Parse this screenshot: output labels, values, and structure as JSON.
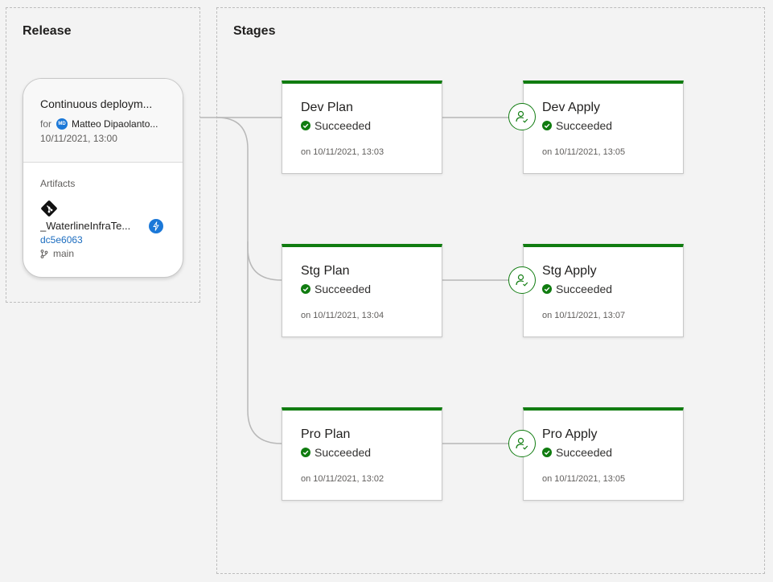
{
  "release_section": {
    "title": "Release"
  },
  "stages_section": {
    "title": "Stages"
  },
  "release_card": {
    "title": "Continuous deploym...",
    "for_label": "for",
    "user_initials": "MD",
    "user": "Matteo Dipaolanto...",
    "time": "10/11/2021, 13:00",
    "artifacts_label": "Artifacts",
    "artifact_icon": "git-icon",
    "artifact_name": "_WaterlineInfraTe...",
    "trigger_icon": "lightning-bolt-icon",
    "commit": "dc5e6063",
    "branch_icon": "branch-icon",
    "branch": "main"
  },
  "stages": {
    "dev_plan": {
      "name": "Dev Plan",
      "status": "Succeeded",
      "time": "on 10/11/2021, 13:03"
    },
    "dev_apply": {
      "name": "Dev Apply",
      "status": "Succeeded",
      "time": "on 10/11/2021, 13:05"
    },
    "stg_plan": {
      "name": "Stg Plan",
      "status": "Succeeded",
      "time": "on 10/11/2021, 13:04"
    },
    "stg_apply": {
      "name": "Stg Apply",
      "status": "Succeeded",
      "time": "on 10/11/2021, 13:07"
    },
    "pro_plan": {
      "name": "Pro Plan",
      "status": "Succeeded",
      "time": "on 10/11/2021, 13:02"
    },
    "pro_apply": {
      "name": "Pro Apply",
      "status": "Succeeded",
      "time": "on 10/11/2021, 13:05"
    }
  },
  "colors": {
    "success": "#107c10",
    "accent": "#1b78d8",
    "connector": "#b8b8b8"
  }
}
